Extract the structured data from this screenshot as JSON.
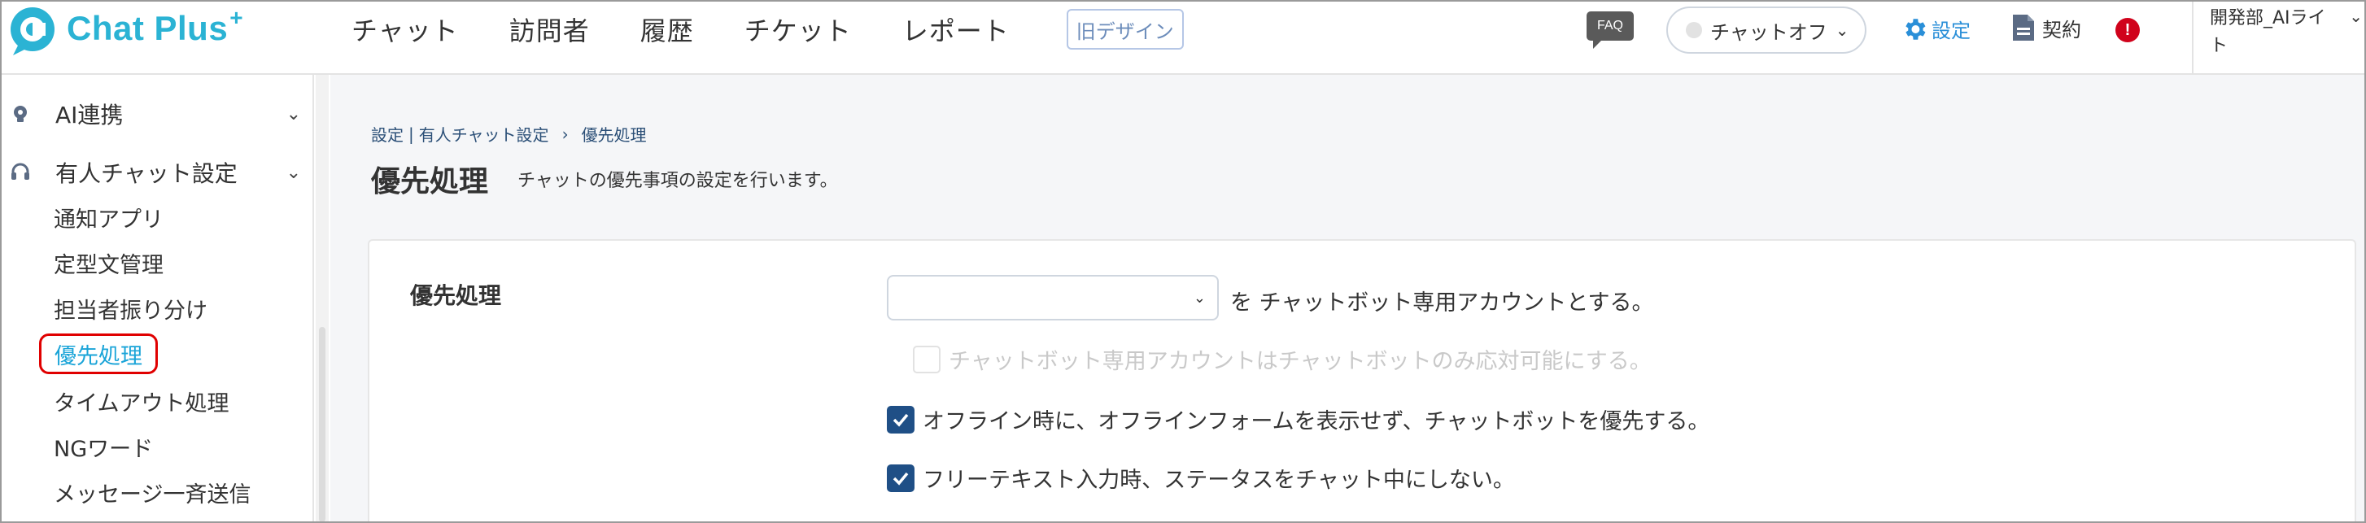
{
  "app": {
    "logo_text": "Chat Plus",
    "logo_plus": "+"
  },
  "topnav": {
    "items": [
      "チャット",
      "訪問者",
      "履歴",
      "チケット",
      "レポート"
    ],
    "old_design": "旧デザイン"
  },
  "header": {
    "faq": "FAQ",
    "chat_status": "チャットオフ",
    "settings": "設定",
    "contract": "契約",
    "alert": "!",
    "user_name": "開発部_AIライト"
  },
  "sidebar": {
    "sections": [
      {
        "label": "AI連携",
        "icon": "bulb-icon"
      },
      {
        "label": "有人チャット設定",
        "icon": "headset-icon"
      }
    ],
    "items": [
      "通知アプリ",
      "定型文管理",
      "担当者振り分け",
      "優先処理",
      "タイムアウト処理",
      "NGワード",
      "メッセージ一斉送信"
    ],
    "active_index": 3
  },
  "breadcrumb": {
    "part1": "設定",
    "sep": "|",
    "part2": "有人チャット設定",
    "arrow": "›",
    "current": "優先処理"
  },
  "page": {
    "title": "優先処理",
    "description": "チャットの優先事項の設定を行います。"
  },
  "form": {
    "label": "優先処理",
    "select_value": "",
    "select_suffix": "を チャットボット専用アカウントとする。",
    "options": [
      {
        "label": "チャットボット専用アカウントはチャットボットのみ応対可能にする。",
        "checked": false,
        "disabled": true
      },
      {
        "label": "オフライン時に、オフラインフォームを表示せず、チャットボットを優先する。",
        "checked": true,
        "disabled": false
      },
      {
        "label": "フリーテキスト入力時、ステータスをチャット中にしない。",
        "checked": true,
        "disabled": false
      }
    ]
  },
  "colors": {
    "accent": "#2bb3d4",
    "link": "#2a8fd8",
    "checkbox": "#1f4f86",
    "highlight": "#e00000",
    "alert": "#d0021b"
  }
}
